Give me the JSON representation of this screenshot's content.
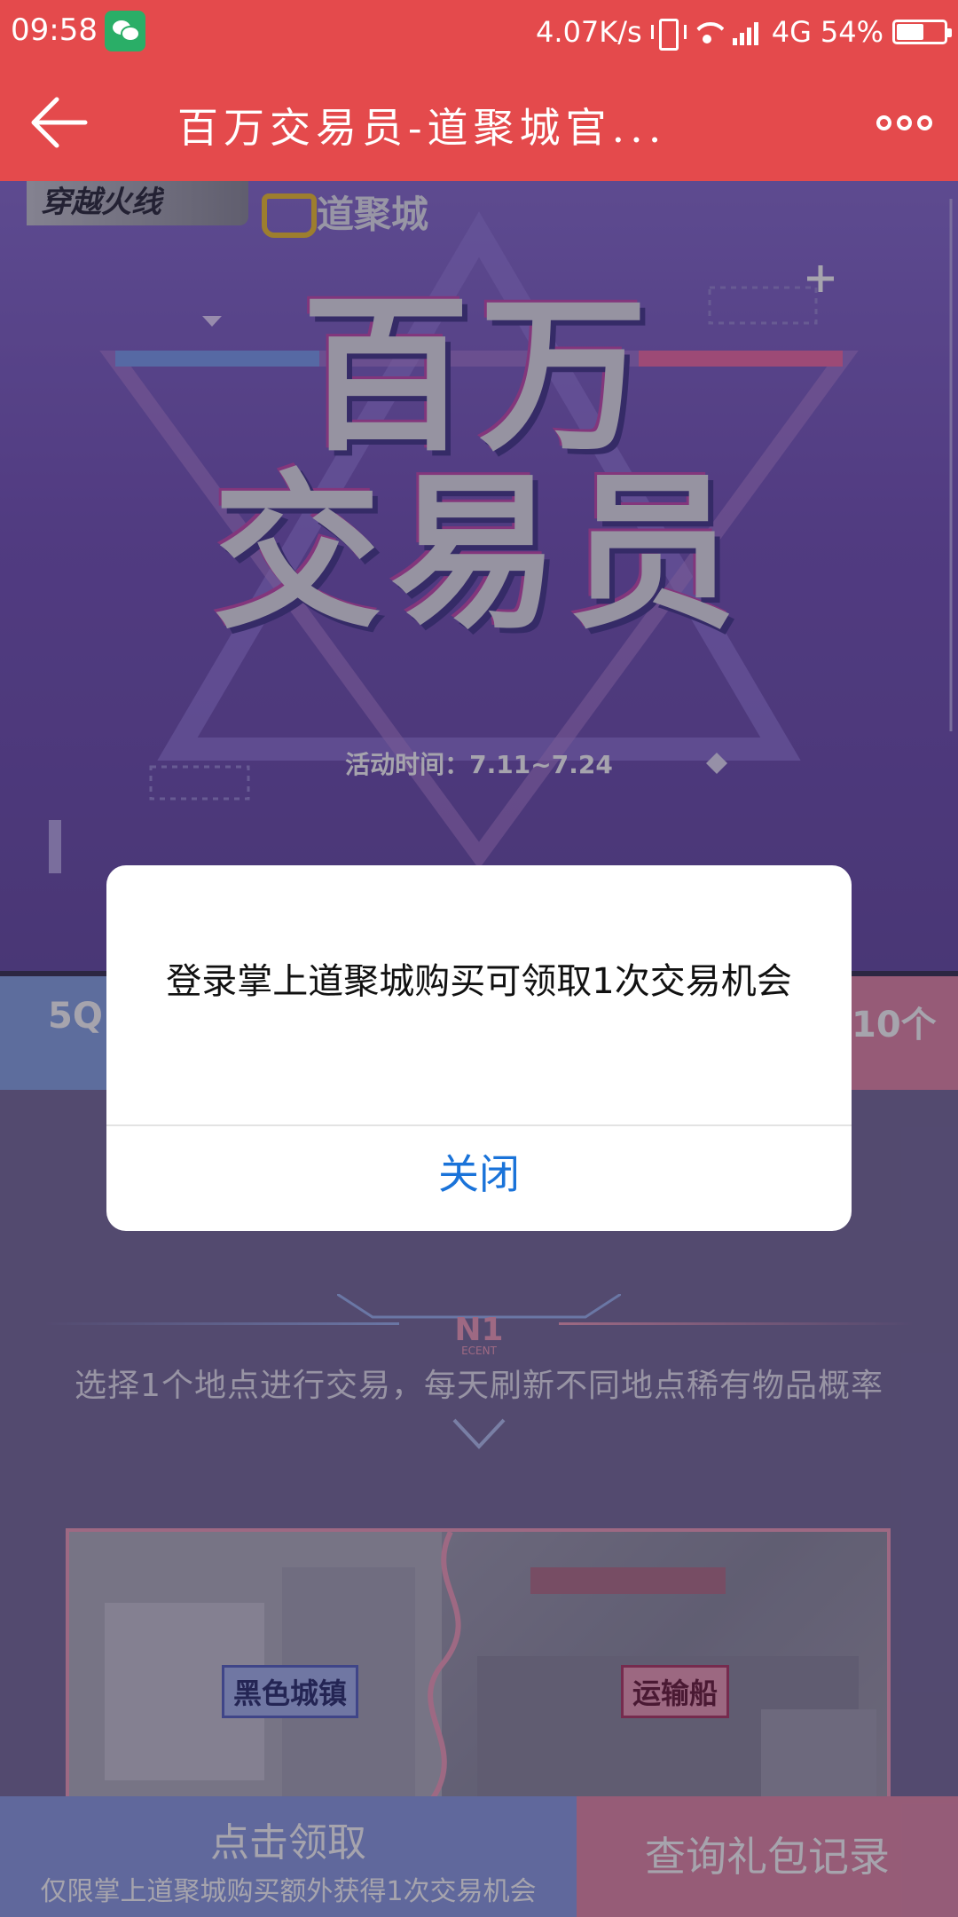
{
  "status_bar": {
    "time": "09:58",
    "network_speed": "4.07K/s",
    "network_type": "4G",
    "battery": "54%",
    "battery_level": 0.54,
    "icons": [
      "wechat-icon",
      "vibrate-icon",
      "wifi-icon",
      "signal-icon",
      "battery-icon"
    ]
  },
  "title_bar": {
    "title": "百万交易员-道聚城官...",
    "back_icon": "back-arrow-icon",
    "more_icon": "more-dots-icon"
  },
  "hero": {
    "cf_logo": "穿越火线",
    "djc_logo": "道聚城",
    "title_line1": "百万",
    "title_line2": "交易员",
    "date": "活动时间：7.11~7.24"
  },
  "prizes": {
    "left_partial": "5Q",
    "right_partial": "10个"
  },
  "section": {
    "badge": "N1",
    "badge_sub": "ECENT",
    "subtitle": "选择1个地点进行交易，每天刷新不同地点稀有物品概率"
  },
  "map": {
    "location1": "黑色城镇",
    "location2": "运输船"
  },
  "bottom": {
    "claim_title": "点击领取",
    "claim_sub": "仅限掌上道聚城购买额外获得1次交易机会",
    "records": "查询礼包记录"
  },
  "modal": {
    "message": "登录掌上道聚城购买可领取1次交易机会",
    "close": "关闭"
  },
  "colors": {
    "header": "#e44a4c",
    "link_blue": "#1a73d9",
    "claim_bg": "#8f9fe4",
    "records_bg": "#e58ba9"
  }
}
